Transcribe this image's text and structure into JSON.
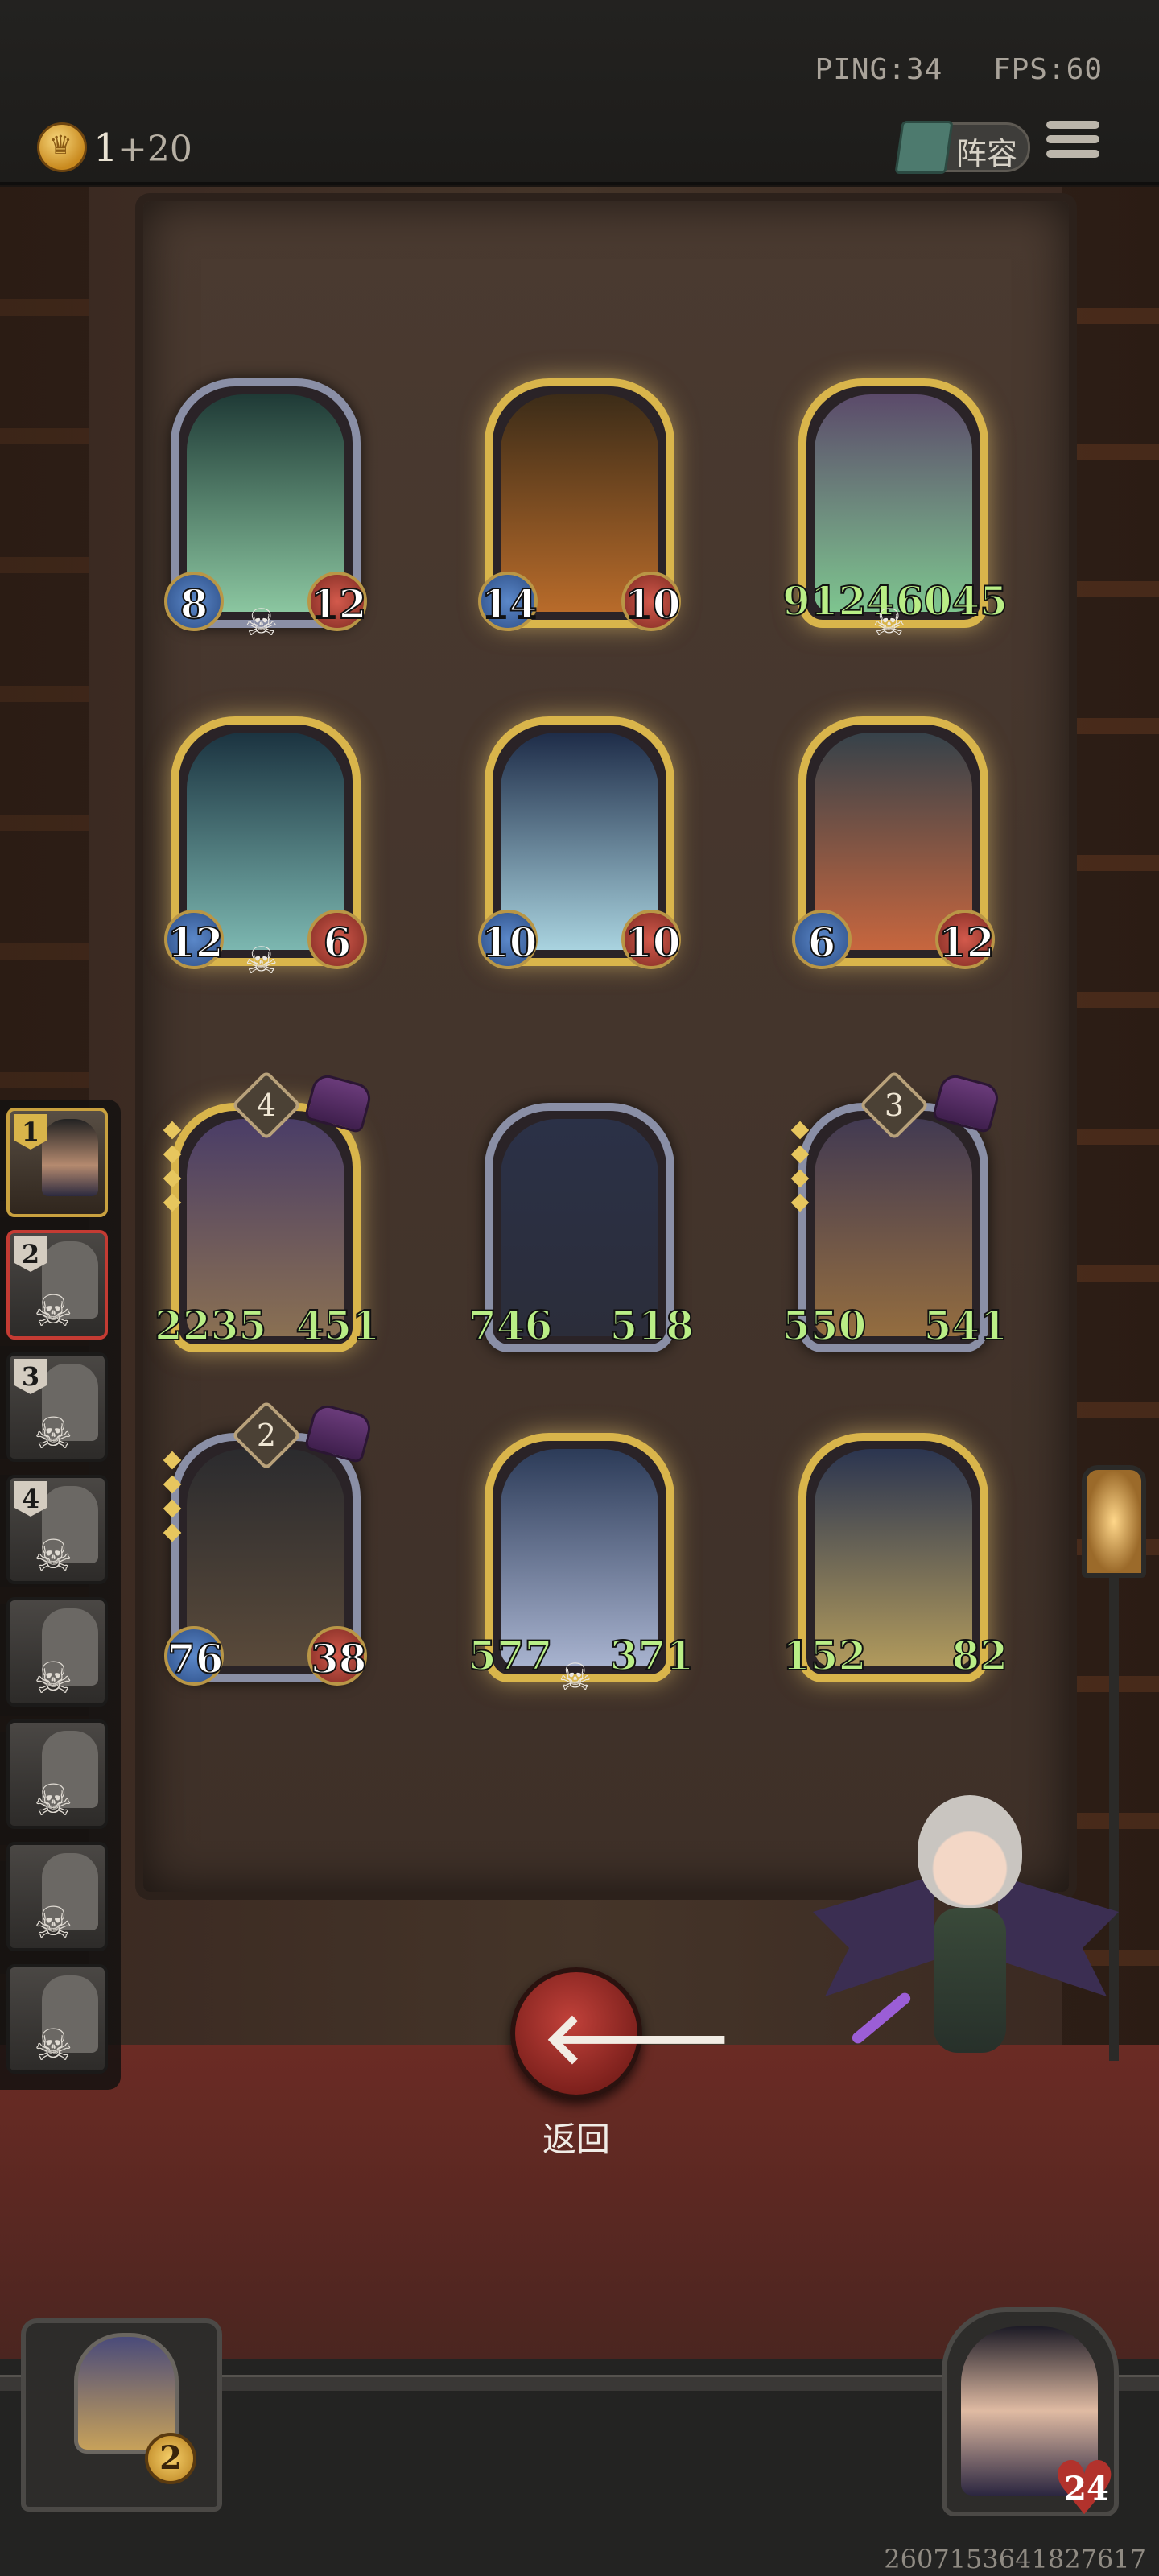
{
  "status": {
    "ping": "PING:34",
    "fps": "FPS:60"
  },
  "gold": {
    "value": "1",
    "increment": "+20"
  },
  "header": {
    "lineup_label": "阵容"
  },
  "board": {
    "shop_cards": [
      {
        "attack": "8",
        "health": "12",
        "frame": "silver",
        "art": [
          "#1f3a36",
          "#8bc6a0"
        ]
      },
      {
        "attack": "14",
        "health": "10",
        "frame": "gold",
        "art": [
          "#3c2c18",
          "#b86b2a"
        ]
      },
      {
        "attack": "9124",
        "health": "6045",
        "frame": "gold",
        "art": [
          "#5b4a6a",
          "#7ec58f"
        ],
        "big": true
      },
      {
        "attack": "12",
        "health": "6",
        "frame": "gold",
        "art": [
          "#1b3340",
          "#7cb7b0"
        ]
      },
      {
        "attack": "10",
        "health": "10",
        "frame": "gold",
        "art": [
          "#1e2c48",
          "#a9d3df"
        ]
      },
      {
        "attack": "6",
        "health": "12",
        "frame": "gold",
        "art": [
          "#36424a",
          "#c7663e"
        ]
      }
    ],
    "team_cards": [
      {
        "tier": "4",
        "attack": "2235",
        "health": "451",
        "frame": "gold",
        "art": [
          "#4a3d67",
          "#8a7052"
        ]
      },
      {
        "attack": "746",
        "health": "518",
        "frame": "silver",
        "art": [
          "#2b3147",
          "#2b2d3a"
        ]
      },
      {
        "tier": "3",
        "attack": "550",
        "health": "541",
        "frame": "silver",
        "art": [
          "#423a52",
          "#946d3f"
        ]
      },
      {
        "tier": "2",
        "attack": "76",
        "health": "38",
        "frame": "silver",
        "art": [
          "#2b2b2e",
          "#5a4a3a"
        ]
      },
      {
        "attack": "577",
        "health": "371",
        "frame": "gold",
        "art": [
          "#2c3b58",
          "#a8b3cf"
        ]
      },
      {
        "attack": "152",
        "health": "82",
        "frame": "gold",
        "art": [
          "#2b3550",
          "#b19a5c"
        ]
      }
    ]
  },
  "roster": {
    "slots": [
      {
        "num": "1"
      },
      {
        "num": "2"
      },
      {
        "num": "3"
      },
      {
        "num": "4"
      },
      {
        "num": ""
      },
      {
        "num": ""
      },
      {
        "num": ""
      },
      {
        "num": ""
      }
    ]
  },
  "actions": {
    "back_label": "返回"
  },
  "player": {
    "level": "2",
    "health": "24"
  },
  "seed": "2607153641827617"
}
